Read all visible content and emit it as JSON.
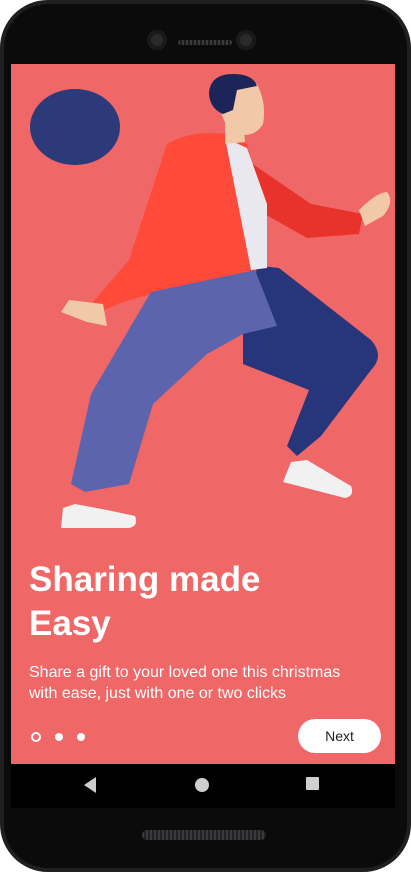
{
  "onboarding": {
    "title_line1": "Sharing made",
    "title_line2": "Easy",
    "description_line1": "Share a gift to your loved one this christmas",
    "description_line2": "with ease, just with one or two clicks",
    "pagination": {
      "total": 3,
      "current": 1
    },
    "next_label": "Next"
  },
  "illustration": {
    "subject": "person-running-icon"
  },
  "navbar": {
    "back_icon": "back-triangle-icon",
    "home_icon": "home-circle-icon",
    "recent_icon": "recent-square-icon"
  },
  "colors": {
    "background": "#ef6767",
    "accent_navy": "#2c3a7a",
    "jacket_red": "#ff4a3a",
    "pants_blue": "#5b64ad",
    "text": "#ffffff"
  }
}
